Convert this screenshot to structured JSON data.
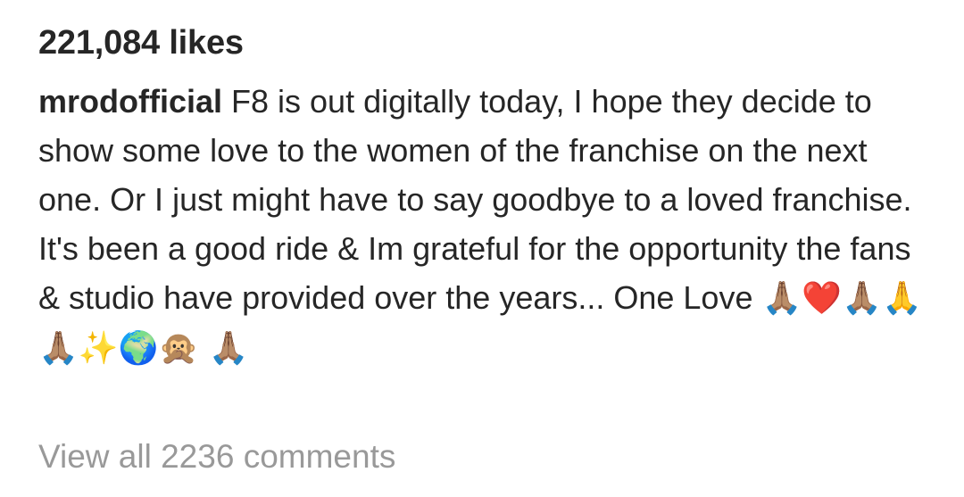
{
  "post": {
    "likes": "221,084 likes",
    "caption": {
      "username": "mrodofficial",
      "text": " F8 is out digitally today, I hope they decide to show some love to the women of the franchise on the next one. Or I just might have to say goodbye to a loved franchise. It's been a good ride & Im grateful for the opportunity the fans & studio have provided over the years... One Love ",
      "emojis": "🙏🏽❤️🙏🏽🙏🙏🏽✨🌍🙊 🙏🏽"
    },
    "view_comments": "View all 2236 comments"
  }
}
